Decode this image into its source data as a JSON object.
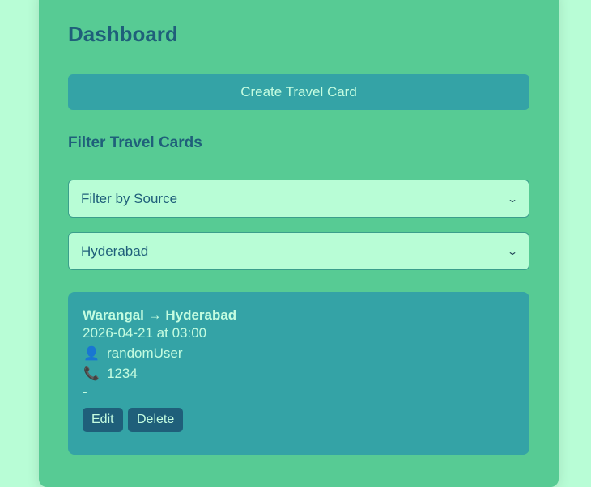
{
  "dashboard": {
    "title": "Dashboard",
    "create_button_label": "Create Travel Card",
    "filter_heading": "Filter Travel Cards"
  },
  "filters": {
    "source_select": {
      "selected": "Filter by Source",
      "icon": "chevron-down-icon"
    },
    "destination_select": {
      "selected": "Hyderabad",
      "icon": "chevron-down-icon"
    }
  },
  "travel_cards": [
    {
      "route": "Warangal → Hyderabad",
      "datetime": "2026-04-21 at 03:00",
      "user_icon": "user-icon",
      "user": "randomUser",
      "phone_icon": "phone-icon",
      "phone": "1234",
      "note": "-",
      "edit_label": "Edit",
      "delete_label": "Delete"
    }
  ],
  "colors": {
    "page_background": "#b8fdd6",
    "panel_background": "#57cb94",
    "accent": "#34a3a6",
    "heading_text": "#1f5f7a",
    "button_dark": "#1f5f7a"
  }
}
